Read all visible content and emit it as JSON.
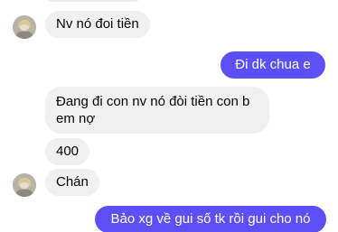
{
  "conversation": {
    "messages": [
      {
        "sender": "other",
        "text": "Nv nó đoi tiền"
      },
      {
        "sender": "me",
        "text": "Đi dk chua e"
      },
      {
        "sender": "other",
        "text_line1": "Đang đi con nv nó đòi tiền con b",
        "text_line2": "em nợ"
      },
      {
        "sender": "other",
        "text": "400"
      },
      {
        "sender": "other",
        "text": "Chán"
      },
      {
        "sender": "me",
        "text": "Bảo xg về gui số tk rồi gui cho nó"
      }
    ]
  },
  "colors": {
    "sent_bubble": "#5b4ff5",
    "received_bubble": "#f0f0f0",
    "background": "#ffffff"
  }
}
